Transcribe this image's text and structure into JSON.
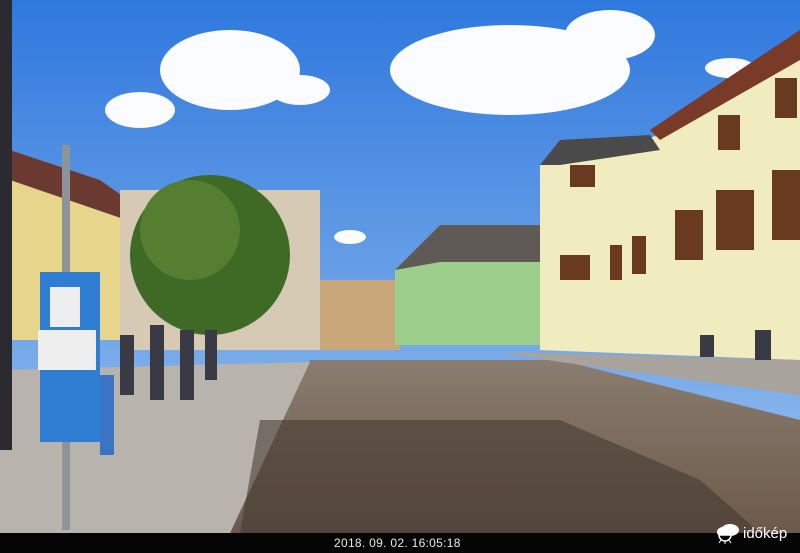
{
  "photo": {
    "timestamp": "2018. 09. 02. 16:05:18",
    "watermark": "időkép"
  },
  "colors": {
    "sky": "#3f86e0",
    "road": "#7a6a5c",
    "building": "#efe7b8"
  }
}
